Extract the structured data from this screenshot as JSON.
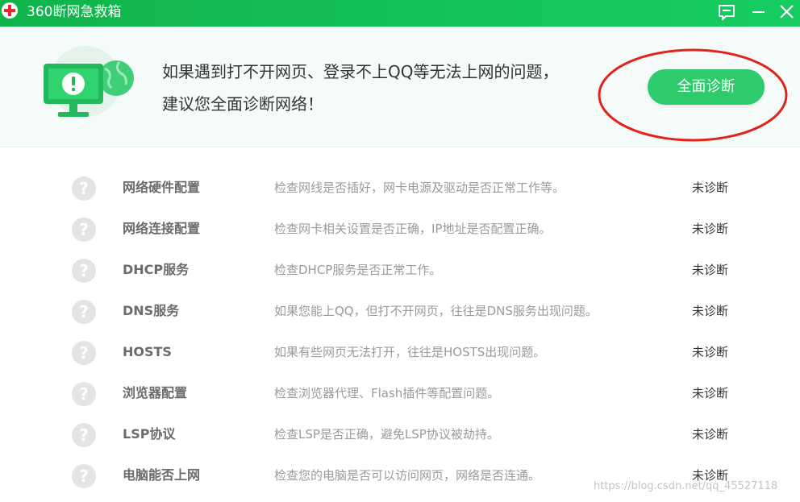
{
  "window": {
    "title": "360断网急救箱"
  },
  "titlebar": {
    "buttons": [
      {
        "name": "feedback",
        "icon": "feedback-icon"
      },
      {
        "name": "minimize",
        "icon": "minimize-icon"
      },
      {
        "name": "close",
        "icon": "close-icon"
      }
    ]
  },
  "banner": {
    "line1": "如果遇到打不开网页、登录不上QQ等无法上网的问题，",
    "line2": "建议您全面诊断网络！",
    "button_label": "全面诊断",
    "illustration_icon": "monitor-warning-globe-icon"
  },
  "checks": [
    {
      "name": "网络硬件配置",
      "desc": "检查网线是否插好，网卡电源及驱动是否正常工作等。",
      "status": "未诊断",
      "icon": "question-icon"
    },
    {
      "name": "网络连接配置",
      "desc": "检查网卡相关设置是否正确，IP地址是否配置正确。",
      "status": "未诊断",
      "icon": "question-icon"
    },
    {
      "name": "DHCP服务",
      "desc": "检查DHCP服务是否正常工作。",
      "status": "未诊断",
      "icon": "question-icon"
    },
    {
      "name": "DNS服务",
      "desc": "如果您能上QQ，但打不开网页，往往是DNS服务出现问题。",
      "status": "未诊断",
      "icon": "question-icon"
    },
    {
      "name": "HOSTS",
      "desc": "如果有些网页无法打开，往往是HOSTS出现问题。",
      "status": "未诊断",
      "icon": "question-icon"
    },
    {
      "name": "浏览器配置",
      "desc": "检查浏览器代理、Flash插件等配置问题。",
      "status": "未诊断",
      "icon": "question-icon"
    },
    {
      "name": "LSP协议",
      "desc": "检查LSP是否正确，避免LSP协议被劫持。",
      "status": "未诊断",
      "icon": "question-icon"
    },
    {
      "name": "电脑能否上网",
      "desc": "检查您的电脑是否可以访问网页，网络是否连通。",
      "status": "未诊断",
      "icon": "question-icon"
    }
  ],
  "watermark": "https://blog.csdn.net/qq_45527118",
  "colors": {
    "titlebar": "#14c45a",
    "button": "#2ecb6c",
    "annotation": "#e3221c",
    "banner_bg": "#f5fbf8"
  }
}
